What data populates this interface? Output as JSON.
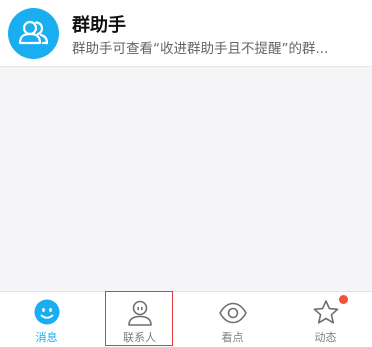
{
  "chat_list": {
    "items": [
      {
        "title": "群助手",
        "preview": "群助手可查看“收进群助手且不提醒”的群..."
      }
    ]
  },
  "tabbar": {
    "tabs": [
      {
        "label": "消息",
        "icon": "message-face-icon",
        "active": true
      },
      {
        "label": "联系人",
        "icon": "contacts-person-icon",
        "active": false
      },
      {
        "label": "看点",
        "icon": "eye-icon",
        "active": false
      },
      {
        "label": "动态",
        "icon": "star-icon",
        "active": false,
        "badge": "red-dot"
      }
    ]
  },
  "colors": {
    "accent": "#19aef0",
    "badge": "#f2513b",
    "highlight_box": "#e63a3a"
  }
}
